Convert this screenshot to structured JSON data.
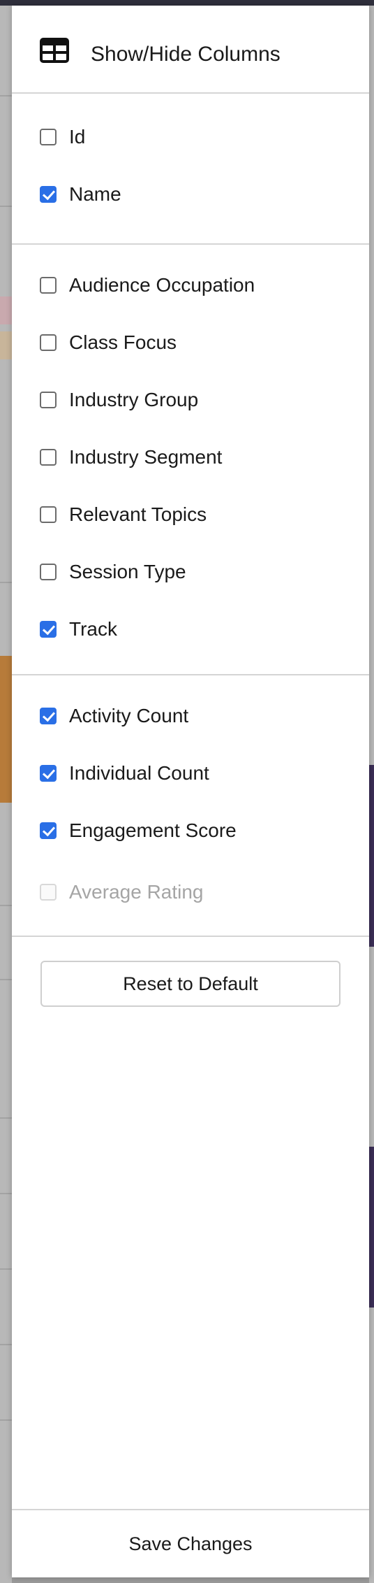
{
  "panel": {
    "title": "Show/Hide Columns",
    "icon": "table-grid-icon"
  },
  "sections": [
    {
      "options": [
        {
          "label": "Id",
          "checked": false,
          "disabled": false
        },
        {
          "label": "Name",
          "checked": true,
          "disabled": false
        }
      ]
    },
    {
      "options": [
        {
          "label": "Audience Occupation",
          "checked": false,
          "disabled": false
        },
        {
          "label": "Class Focus",
          "checked": false,
          "disabled": false
        },
        {
          "label": "Industry Group",
          "checked": false,
          "disabled": false
        },
        {
          "label": "Industry Segment",
          "checked": false,
          "disabled": false
        },
        {
          "label": "Relevant Topics",
          "checked": false,
          "disabled": false
        },
        {
          "label": "Session Type",
          "checked": false,
          "disabled": false
        },
        {
          "label": "Track",
          "checked": true,
          "disabled": false
        }
      ]
    },
    {
      "options": [
        {
          "label": "Activity Count",
          "checked": true,
          "disabled": false
        },
        {
          "label": "Individual Count",
          "checked": true,
          "disabled": false
        },
        {
          "label": "Engagement Score",
          "checked": true,
          "disabled": false
        },
        {
          "label": "Average Rating",
          "checked": false,
          "disabled": true
        }
      ]
    }
  ],
  "actions": {
    "reset_label": "Reset to Default",
    "save_label": "Save Changes"
  },
  "colors": {
    "accent": "#2a6fe6",
    "divider": "#d5d5d5",
    "disabled_text": "#a5a5a5"
  }
}
